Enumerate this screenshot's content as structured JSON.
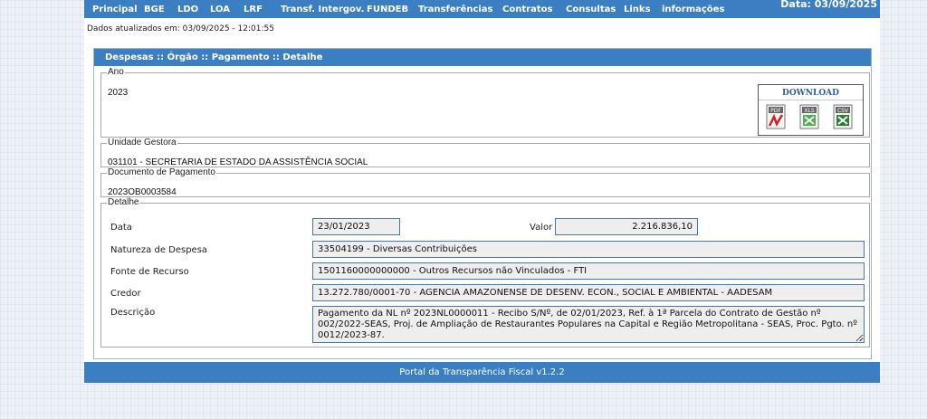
{
  "nav": {
    "items": [
      "Principal",
      "BGE",
      "LDO",
      "LOA",
      "LRF",
      "Transf. Intergov.",
      "FUNDEB",
      "Transferências",
      "Contratos",
      "Consultas",
      "Links",
      "informações"
    ],
    "date": "Data: 03/09/2025"
  },
  "updated": "Dados atualizados em: 03/09/2025 - 12:01:55",
  "panel": {
    "title": "Despesas :: Órgão :: Pagamento :: Detalhe",
    "ano": {
      "legend": "Ano",
      "value": "2023"
    },
    "download": {
      "title": "DOWNLOAD",
      "icons": [
        {
          "label": "PDF",
          "icon": "pdf-file-icon",
          "color": "#cc2222"
        },
        {
          "label": "XLS",
          "icon": "xls-file-icon",
          "color": "#2e7d32"
        },
        {
          "label": "CSV",
          "icon": "csv-file-icon",
          "color": "#2e7d32"
        }
      ]
    },
    "unidade": {
      "legend": "Unidade Gestora",
      "value": "031101 - SECRETARIA DE ESTADO DA ASSISTÊNCIA SOCIAL"
    },
    "documento": {
      "legend": "Documento de Pagamento",
      "value": "2023OB0003584"
    },
    "detalhe": {
      "legend": "Detalhe",
      "data_label": "Data",
      "data_value": "23/01/2023",
      "valor_label": "Valor",
      "valor_value": "2.216.836,10",
      "natureza_label": "Natureza de Despesa",
      "natureza_value": "33504199 - Diversas Contribuições",
      "fonte_label": "Fonte de Recurso",
      "fonte_value": "1501160000000000 - Outros Recursos não Vinculados - FTI",
      "credor_label": "Credor",
      "credor_value": "13.272.780/0001-70 - AGENCIA AMAZONENSE DE DESENV. ECON., SOCIAL E AMBIENTAL - AADESAM",
      "descricao_label": "Descrição",
      "descricao_value": "Pagamento da NL nº 2023NL0000011 - Recibo S/Nº, de 02/01/2023, Ref. à 1ª Parcela do Contrato de Gestão nº 002/2022-SEAS, Proj. de Ampliação de Restaurantes Populares na Capital e Região Metropolitana - SEAS, Proc. Pgto. nº 0012/2023-87."
    }
  },
  "footer": "Portal da Transparência Fiscal v1.2.2",
  "colors": {
    "header_blue": "#3b7fc2",
    "field_border": "#4a76a8",
    "field_bg": "#eeeeee"
  }
}
